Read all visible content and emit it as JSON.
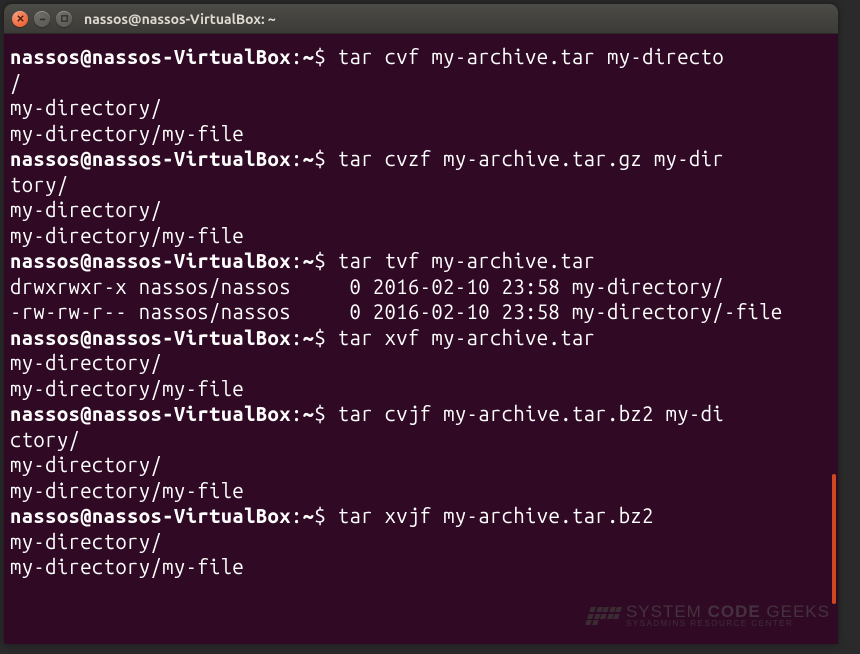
{
  "window": {
    "title": "nassos@nassos-VirtualBox: ~"
  },
  "prompt": {
    "user_host": "nassos@nassos-VirtualBox",
    "path": "~",
    "symbol": "$"
  },
  "lines": [
    {
      "type": "cmd",
      "text": "tar cvf my-archive.tar my-directo"
    },
    {
      "type": "wrap",
      "text": "/"
    },
    {
      "type": "out",
      "text": "my-directory/"
    },
    {
      "type": "out",
      "text": "my-directory/my-file"
    },
    {
      "type": "cmd",
      "text": "tar cvzf my-archive.tar.gz my-dir"
    },
    {
      "type": "wrap",
      "text": "tory/"
    },
    {
      "type": "out",
      "text": "my-directory/"
    },
    {
      "type": "out",
      "text": "my-directory/my-file"
    },
    {
      "type": "cmd",
      "text": "tar tvf my-archive.tar"
    },
    {
      "type": "out",
      "text": "drwxrwxr-x nassos/nassos     0 2016-02-10 23:58 my-directory/"
    },
    {
      "type": "out",
      "text": "-rw-rw-r-- nassos/nassos     0 2016-02-10 23:58 my-directory/-file"
    },
    {
      "type": "cmd",
      "text": "tar xvf my-archive.tar"
    },
    {
      "type": "out",
      "text": "my-directory/"
    },
    {
      "type": "out",
      "text": "my-directory/my-file"
    },
    {
      "type": "cmd",
      "text": "tar cvjf my-archive.tar.bz2 my-di"
    },
    {
      "type": "wrap",
      "text": "ctory/"
    },
    {
      "type": "out",
      "text": "my-directory/"
    },
    {
      "type": "out",
      "text": "my-directory/my-file"
    },
    {
      "type": "cmd",
      "text": "tar xvjf my-archive.tar.bz2"
    },
    {
      "type": "out",
      "text": "my-directory/"
    },
    {
      "type": "out",
      "text": "my-directory/my-file"
    }
  ],
  "watermark": {
    "line1a": "SYSTEM ",
    "line1b": "CODE",
    "line1c": " GEEKS",
    "line2": "SYSADMINS RESOURCE CENTER"
  }
}
